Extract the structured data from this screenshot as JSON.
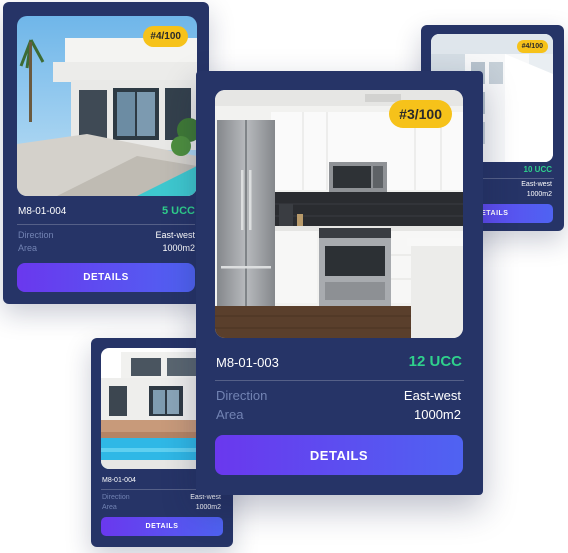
{
  "cards": [
    {
      "badge": "#4/100",
      "code": "M8-01-004",
      "price": "5 UCC",
      "direction_label": "Direction",
      "direction_value": "East-west",
      "area_label": "Area",
      "area_value": "1000m2",
      "button": "DETAILS"
    },
    {
      "badge": "#4/100",
      "code": "",
      "price": "10 UCC",
      "direction_label": "",
      "direction_value": "East-west",
      "area_label": "",
      "area_value": "1000m2",
      "button": "DETAILS"
    },
    {
      "badge": "#3/100",
      "code": "M8-01-003",
      "price": "12 UCC",
      "direction_label": "Direction",
      "direction_value": "East-west",
      "area_label": "Area",
      "area_value": "1000m2",
      "button": "DETAILS"
    },
    {
      "badge": "",
      "code": "M8-01-004",
      "price": "",
      "direction_label": "Direction",
      "direction_value": "East-west",
      "area_label": "Area",
      "area_value": "1000m2",
      "button": "DETAILS"
    }
  ],
  "colors": {
    "card_bg": "#263467",
    "price": "#2fd08c",
    "badge": "#f6c21a",
    "button_start": "#6a38ee",
    "button_end": "#4f63f2",
    "label": "#7283b3"
  }
}
